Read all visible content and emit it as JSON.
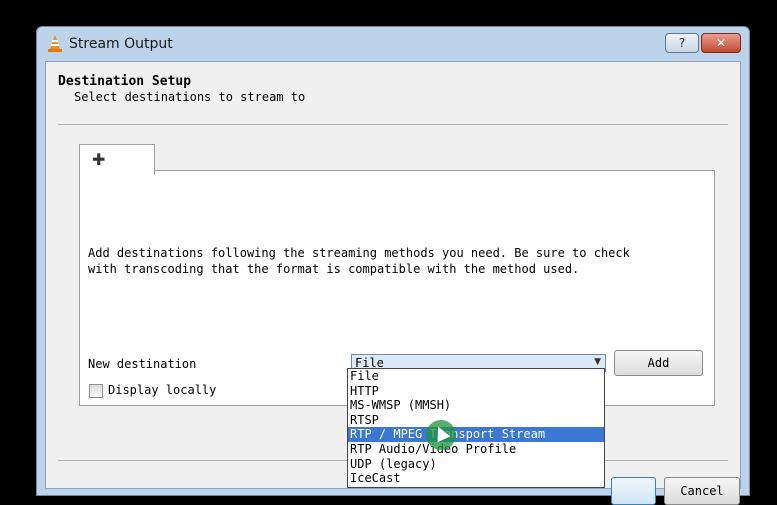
{
  "window": {
    "title": "Stream Output",
    "icon": "vlc-cone-icon",
    "help_label": "?",
    "close_label": "✕"
  },
  "header": {
    "title": "Destination Setup",
    "subtitle": "Select destinations to stream to"
  },
  "tab": {
    "icon": "plus-icon",
    "glyph": "✚"
  },
  "panel": {
    "description": "Add destinations following the streaming methods you need. Be sure to check\nwith transcoding that the format is compatible with the method used.",
    "new_destination_label": "New destination",
    "selected_destination": "File",
    "add_label": "Add",
    "display_locally_label": "Display locally",
    "display_locally_checked": false
  },
  "dropdown": {
    "options": [
      "File",
      "HTTP",
      "MS-WMSP (MMSH)",
      "RTSP",
      "RTP / MPEG Transport Stream",
      "RTP Audio/Video Profile",
      "UDP (legacy)",
      "IceCast"
    ],
    "highlighted_index": 4
  },
  "footer": {
    "ok_label": "",
    "cancel_label": "Cancel"
  }
}
